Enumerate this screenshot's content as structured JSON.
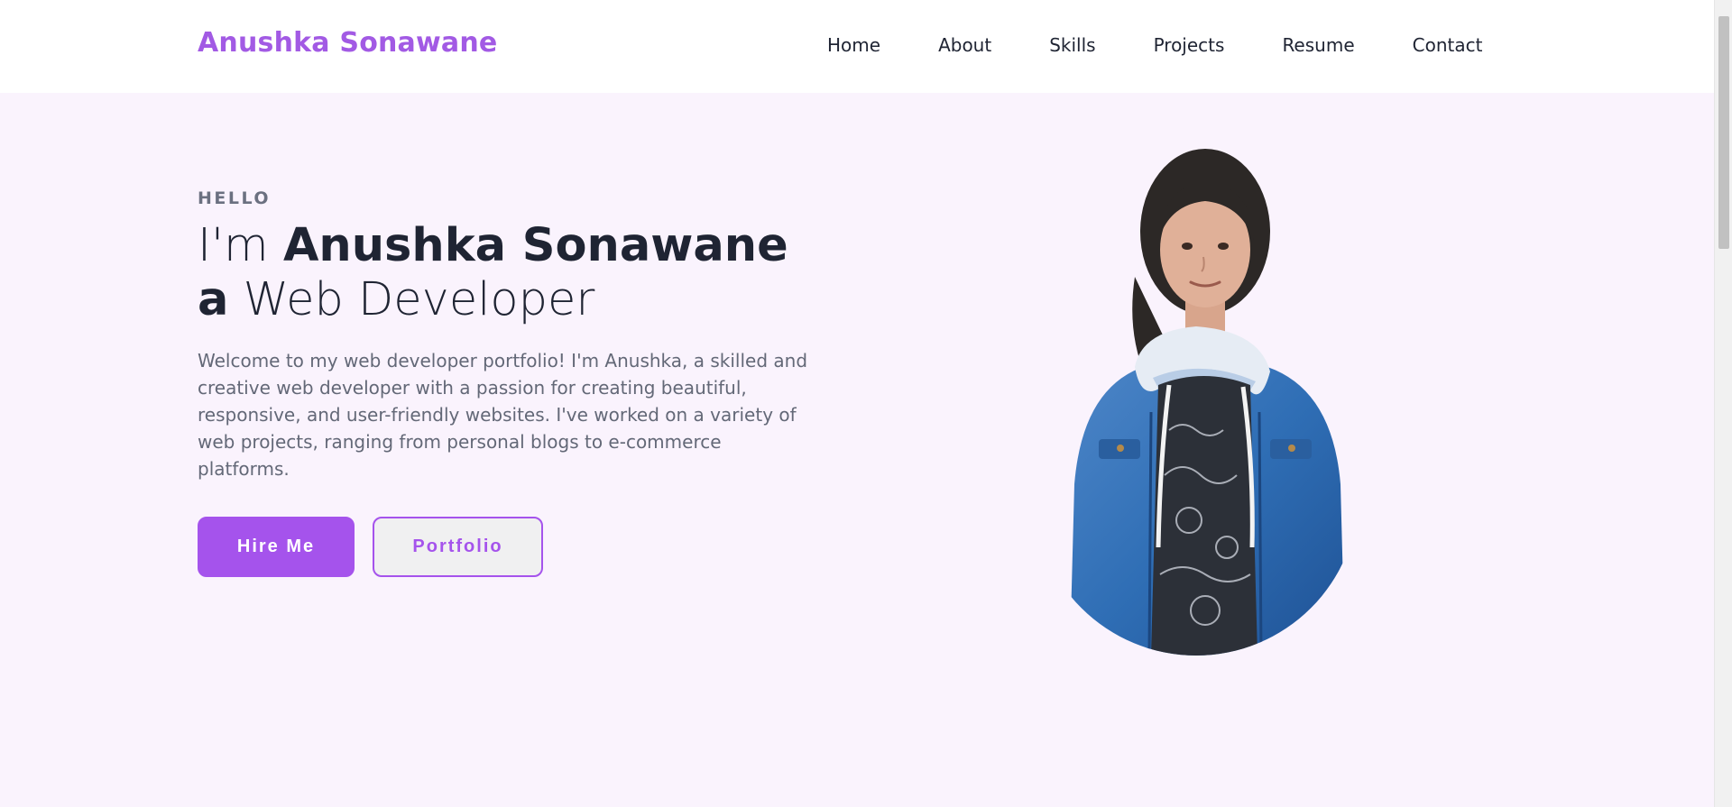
{
  "header": {
    "logo": "Anushka Sonawane",
    "nav": [
      "Home",
      "About",
      "Skills",
      "Projects",
      "Resume",
      "Contact"
    ]
  },
  "hero": {
    "eyebrow": "HELLO",
    "line1_pre": "I'm ",
    "line1_name": "Anushka Sonawane",
    "line2_pre": "a",
    "line2_role": " Web Developer",
    "intro": "Welcome to my web developer portfolio! I'm Anushka, a skilled and creative web developer with a passion for creating beautiful, responsive, and user-friendly websites. I've worked on a variety of web projects, ranging from personal blogs to e-commerce platforms.",
    "primary_button": "Hire Me",
    "secondary_button": "Portfolio"
  },
  "colors": {
    "accent": "#a553ec",
    "logo": "#a25ae4",
    "background": "#faf3fd",
    "text": "#1f2433"
  }
}
